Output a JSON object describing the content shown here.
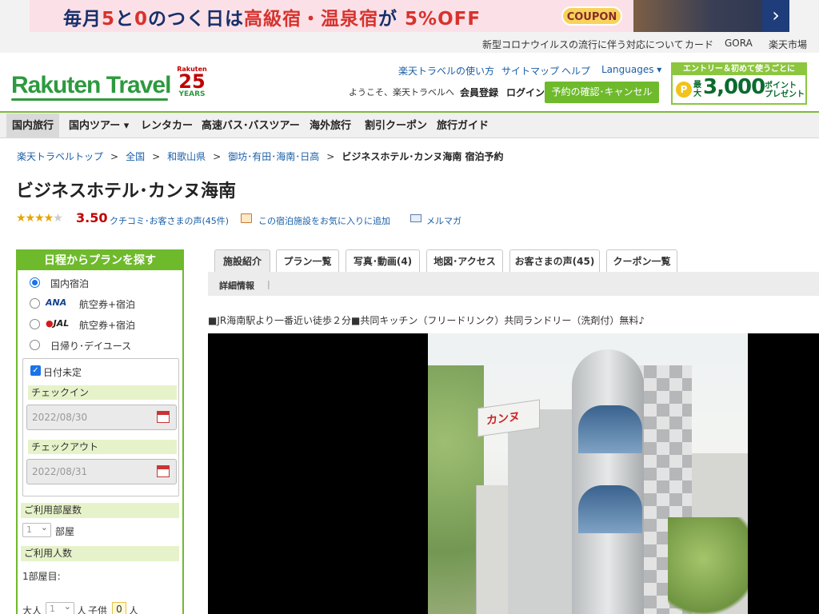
{
  "banner": {
    "text_1": "毎月",
    "text_5": "5",
    "text_2": "と",
    "text_0": "0",
    "text_3": "のつく日は",
    "text_4": "高級宿・温泉宿",
    "text_6": "が",
    "text_off": "5%OFF",
    "coupon": "COUPON"
  },
  "util_links": [
    "新型コロナウイルスの流行に伴う対応について",
    "カード",
    "GORA",
    "楽天市場"
  ],
  "logo": {
    "name": "Rakuten Travel",
    "anniv_top": "Rakuten",
    "anniv_num": "25",
    "anniv_bottom": "YEARS"
  },
  "header": {
    "links": [
      "楽天トラベルの使い方",
      "サイトマップ",
      "ヘルプ",
      "Languages ▾"
    ],
    "welcome": "ようこそ、楽天トラベルへ",
    "register": "会員登録",
    "login": "ログイン",
    "reserve_button": "予約の確認･キャンセル"
  },
  "promo": {
    "top": "エントリー＆初めて使うごとに",
    "max": "最大",
    "amount": "3,000",
    "points": "ポイント プレゼント",
    "coin": "P"
  },
  "nav": {
    "items": [
      "国内旅行",
      "国内ツアー ▾",
      "レンタカー",
      "高速バス･バスツアー",
      "海外旅行",
      "割引クーポン",
      "旅行ガイド"
    ]
  },
  "breadcrumb": [
    "楽天トラベルトップ",
    "全国",
    "和歌山県",
    "御坊･有田･海南･日高"
  ],
  "breadcrumb_sep": ">",
  "breadcrumb_current": "ビジネスホテル･カンヌ海南 宿泊予約",
  "hotel": {
    "name": "ビジネスホテル･カンヌ海南",
    "rating": 3.5,
    "rating_text": "3.50",
    "reviews": "クチコミ･お客さまの声(45件)",
    "favorite": "この宿泊施設をお気に入りに追加",
    "mail": "メルマガ"
  },
  "sidebar": {
    "title": "日程からプランを探す",
    "options": [
      "国内宿泊",
      "航空券+宿泊",
      "航空券+宿泊",
      "日帰り･デイユース"
    ],
    "ana": "ANA",
    "jal": "JAL",
    "date_undecided": "日付未定",
    "checkin_label": "チェックイン",
    "checkin_value": "2022/08/30",
    "checkout_label": "チェックアウト",
    "checkout_value": "2022/08/31",
    "rooms_label": "ご利用部屋数",
    "rooms_value": "1",
    "rooms_unit": "部屋",
    "people_label": "ご利用人数",
    "room1": "1部屋目:",
    "adult_label": "大人",
    "adult_value": "1",
    "adult_unit": "人",
    "child_label": "子供",
    "child_value": "0",
    "child_unit": "人"
  },
  "tabs": [
    "施設紹介",
    "プラン一覧",
    "写真･動画(4)",
    "地図･アクセス",
    "お客さまの声(45)",
    "クーポン一覧"
  ],
  "subtab": "詳細情報",
  "subtab_sep": "|",
  "description": "■JR海南駅より一番近い徒歩２分■共同キッチン（フリードリンク）共同ランドリー（洗剤付）無料♪",
  "photo_sign": "カンヌ"
}
